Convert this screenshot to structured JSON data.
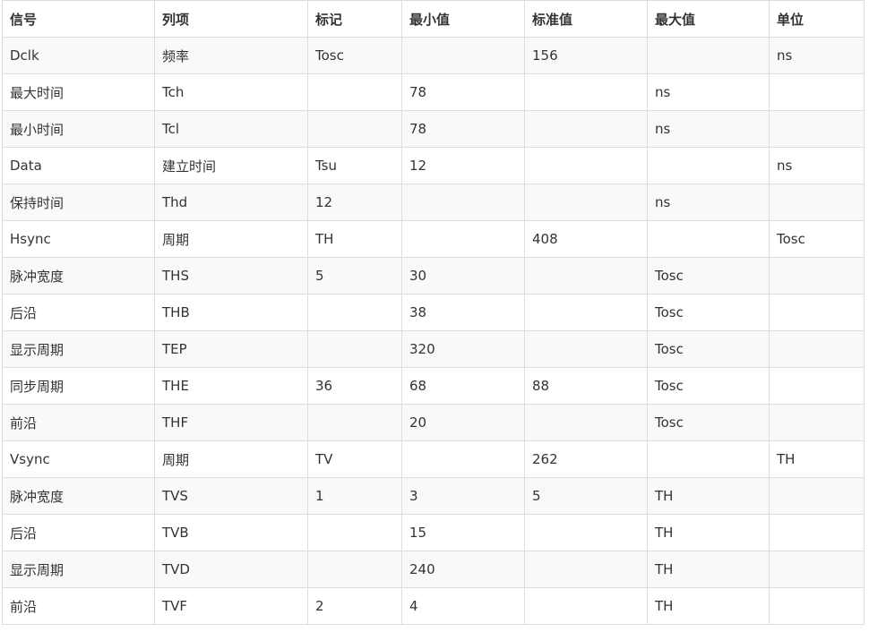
{
  "table": {
    "headers": [
      "信号",
      "列项",
      "标记",
      "最小值",
      "标准值",
      "最大值",
      "单位"
    ],
    "rows": [
      [
        "Dclk",
        "频率",
        "Tosc",
        "",
        "156",
        "",
        "ns"
      ],
      [
        "最大时间",
        "Tch",
        "",
        "78",
        "",
        "ns",
        ""
      ],
      [
        "最小时间",
        "Tcl",
        "",
        "78",
        "",
        "ns",
        ""
      ],
      [
        "Data",
        "建立时间",
        "Tsu",
        "12",
        "",
        "",
        "ns"
      ],
      [
        "保持时间",
        "Thd",
        "12",
        "",
        "",
        "ns",
        ""
      ],
      [
        "Hsync",
        "周期",
        "TH",
        "",
        "408",
        "",
        "Tosc"
      ],
      [
        "脉冲宽度",
        "THS",
        "5",
        "30",
        "",
        "Tosc",
        ""
      ],
      [
        "后沿",
        "THB",
        "",
        "38",
        "",
        "Tosc",
        ""
      ],
      [
        "显示周期",
        "TEP",
        "",
        "320",
        "",
        "Tosc",
        ""
      ],
      [
        "同步周期",
        "THE",
        "36",
        "68",
        "88",
        "Tosc",
        ""
      ],
      [
        "前沿",
        "THF",
        "",
        "20",
        "",
        "Tosc",
        ""
      ],
      [
        "Vsync",
        "周期",
        "TV",
        "",
        "262",
        "",
        "TH"
      ],
      [
        "脉冲宽度",
        "TVS",
        "1",
        "3",
        "5",
        "TH",
        ""
      ],
      [
        "后沿",
        "TVB",
        "",
        "15",
        "",
        "TH",
        ""
      ],
      [
        "显示周期",
        "TVD",
        "",
        "240",
        "",
        "TH",
        ""
      ],
      [
        "前沿",
        "TVF",
        "2",
        "4",
        "",
        "TH",
        ""
      ]
    ]
  }
}
